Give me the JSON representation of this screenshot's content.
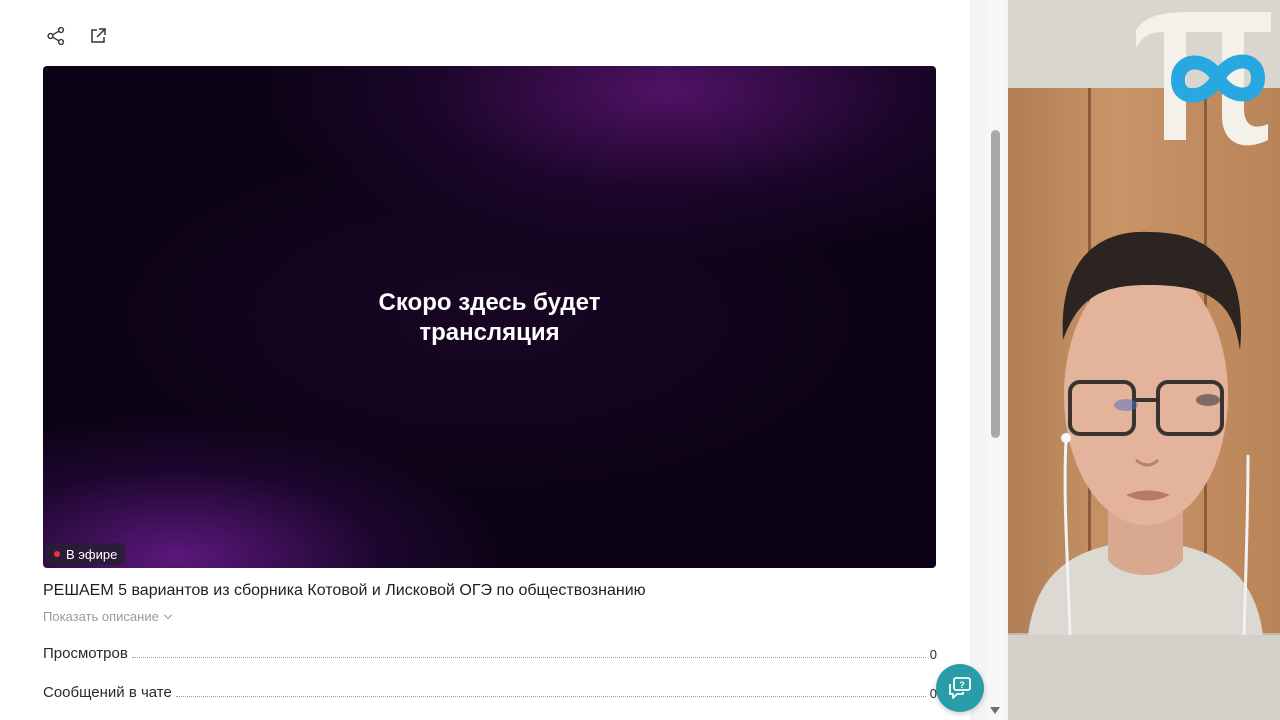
{
  "toolbar": {
    "share_icon": "share-icon",
    "open_external_icon": "external-link-icon"
  },
  "player": {
    "message_line1": "Скоро здесь будет",
    "message_line2": "трансляция",
    "live_label": "В эфире",
    "live_color": "#e53935"
  },
  "stream": {
    "title": "РЕШАЕМ 5 вариантов из сборника Котовой и Лисковой ОГЭ по обществознанию",
    "show_description": "Показать описание"
  },
  "stats": {
    "views_label": "Просмотров",
    "views_value": "0",
    "chat_label": "Сообщений в чате",
    "chat_value": "0"
  },
  "help": {
    "icon": "chat-help-icon",
    "color": "#2a9ca6"
  },
  "colors": {
    "accent": "#2a9ca6",
    "logo_blue": "#28a8e0"
  }
}
